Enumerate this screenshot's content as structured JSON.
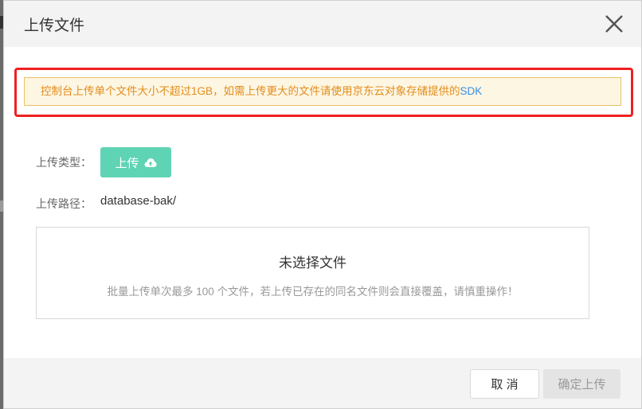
{
  "modal": {
    "title": "上传文件",
    "close_icon": "close-icon"
  },
  "notice": {
    "text": "控制台上传单个文件大小不超过1GB，如需上传更大的文件请使用京东云对象存储提供的",
    "link_text": "SDK",
    "text_color": "#e38d1c",
    "link_color": "#3a8ee6",
    "highlight_color": "#f02020"
  },
  "form": {
    "upload_type_label": "上传类型：",
    "upload_button_label": "上传",
    "upload_button_icon": "cloud-upload-icon",
    "upload_button_color": "#5fd4b4",
    "path_label": "上传路径：",
    "path_value": "database-bak/"
  },
  "drop_zone": {
    "title": "未选择文件",
    "hint": "批量上传单次最多 100 个文件，若上传已存在的同名文件则会直接覆盖，请慎重操作！"
  },
  "footer": {
    "cancel_label": "取 消",
    "confirm_label": "确定上传"
  }
}
